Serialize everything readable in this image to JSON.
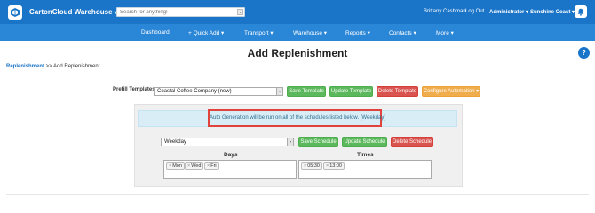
{
  "app": {
    "brand": "CartonCloud Warehouse",
    "search_placeholder": "Search for anything!",
    "user": "Brittany Cashman",
    "logout": "Log Out",
    "role": "Administrator",
    "location": "Sunshine Coast"
  },
  "nav": {
    "items": [
      "Dashboard",
      "+ Quick Add ▾",
      "Transport ▾",
      "Warehouse ▾",
      "Reports ▾",
      "Contacts ▾",
      "More ▾"
    ]
  },
  "page": {
    "title": "Add Replenishment",
    "help": "?",
    "breadcrumb_link": "Replenishment",
    "breadcrumb_rest": " >> Add Replenishment"
  },
  "prefill": {
    "label": "Prefill Templates",
    "selected": "Coastal Coffee Company (new)",
    "save": "Save Template",
    "update": "Update Template",
    "delete": "Delete Template",
    "configure": "Configure Automation ▾"
  },
  "schedule": {
    "notice": "Auto Generation will be run on all of the schedules listed below. [Weekday]",
    "selected": "Weekday",
    "save": "Save Schedule",
    "update": "Update Schedule",
    "delete": "Delete Schedule",
    "days_label": "Days",
    "times_label": "Times",
    "days": [
      "Mon",
      "Wed",
      "Fri"
    ],
    "times": [
      "05:30",
      "13:00"
    ]
  },
  "colors": {
    "topbar": "#1a74c8",
    "navbar": "#2a86d6",
    "green": "#5cb85c",
    "red": "#d9534f",
    "orange": "#f0ad4e",
    "highlight": "#e0433b"
  }
}
